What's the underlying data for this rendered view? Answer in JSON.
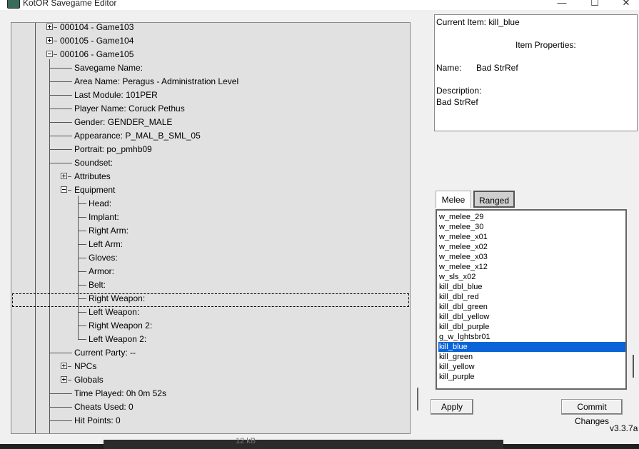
{
  "window": {
    "title": "KotOR Savegame Editor",
    "icon": "app-icon",
    "controls": {
      "minimize": "—",
      "maximize": "☐",
      "close": "✕"
    }
  },
  "tree": {
    "rows": [
      {
        "label": "000104 - Game103",
        "expander": "plus"
      },
      {
        "label": "000105 - Game104",
        "expander": "plus"
      },
      {
        "label": "000106 - Game105",
        "expander": "minus"
      },
      {
        "label": "Savegame Name:"
      },
      {
        "label": "Area Name: Peragus - Administration Level"
      },
      {
        "label": "Last Module: 101PER"
      },
      {
        "label": "Player Name: Coruck Pethus"
      },
      {
        "label": "Gender: GENDER_MALE"
      },
      {
        "label": "Appearance: P_MAL_B_SML_05"
      },
      {
        "label": "Portrait: po_pmhb09"
      },
      {
        "label": "Soundset:"
      },
      {
        "label": "Attributes",
        "expander": "plus"
      },
      {
        "label": "Equipment",
        "expander": "minus"
      },
      {
        "label": "Head:"
      },
      {
        "label": "Implant:"
      },
      {
        "label": "Right Arm:"
      },
      {
        "label": "Left Arm:"
      },
      {
        "label": "Gloves:"
      },
      {
        "label": "Armor:"
      },
      {
        "label": "Belt:"
      },
      {
        "label": "Right Weapon:"
      },
      {
        "label": "Left Weapon:"
      },
      {
        "label": "Right Weapon 2:"
      },
      {
        "label": "Left Weapon 2:"
      },
      {
        "label": "Current Party: --"
      },
      {
        "label": "NPCs",
        "expander": "plus"
      },
      {
        "label": "Globals",
        "expander": "plus"
      },
      {
        "label": "Time Played: 0h 0m 52s"
      },
      {
        "label": "Cheats Used: 0"
      },
      {
        "label": "Hit Points: 0"
      }
    ]
  },
  "properties": {
    "current_item_label": "Current Item: kill_blue",
    "heading": "Item Properties:",
    "name_label": "Name:",
    "name_value": "Bad StrRef",
    "description_label": "Description:",
    "description_value": "Bad StrRef"
  },
  "tabs": [
    {
      "label": "Melee",
      "active": true
    },
    {
      "label": "Ranged",
      "active": false
    }
  ],
  "item_list": {
    "items": [
      "w_melee_29",
      "w_melee_30",
      "w_melee_x01",
      "w_melee_x02",
      "w_melee_x03",
      "w_melee_x12",
      "w_sls_x02",
      "kill_dbl_blue",
      "kill_dbl_red",
      "kill_dbl_green",
      "kill_dbl_yellow",
      "kill_dbl_purple",
      "g_w_lghtsbr01",
      "kill_blue",
      "kill_green",
      "kill_yellow",
      "kill_purple"
    ],
    "selected": "kill_blue"
  },
  "buttons": {
    "apply": "Apply",
    "commit": "Commit Changes"
  },
  "version": "v3.3.7a",
  "status": {
    "size_text": "12 kB"
  },
  "colors": {
    "selection": "#0a64d8",
    "tree_bg": "#e1e1e1"
  }
}
